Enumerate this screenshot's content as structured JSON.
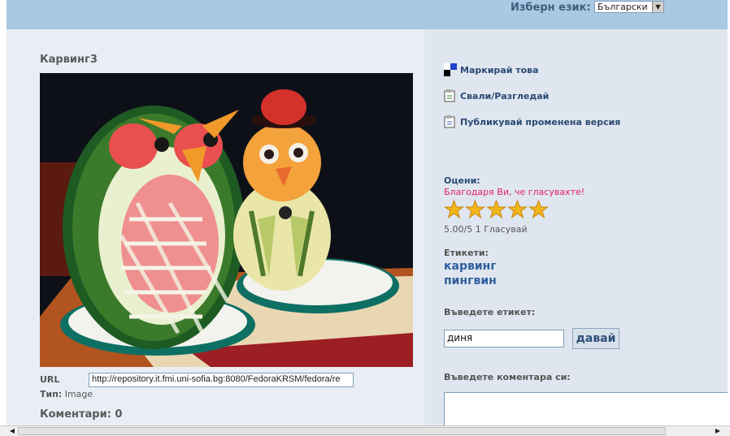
{
  "header": {
    "language_label": "Изберн език:",
    "language_selected": "Български"
  },
  "item": {
    "title": "Карвинг3",
    "url_label": "URL",
    "url_value": "http://repository.it.fmi.uni-sofia.bg:8080/FedoraKRSM/fedora/re",
    "type_label": "Тип:",
    "type_value": "Image",
    "comments_label": "Коментари: 0"
  },
  "actions": [
    {
      "label": "Маркирай това",
      "icon": "bookmark-icon"
    },
    {
      "label": "Свали/Разгледай",
      "icon": "download-icon"
    },
    {
      "label": "Публикувай променена версия",
      "icon": "publish-icon"
    }
  ],
  "rating": {
    "label": "Оцени:",
    "thanks": "Благодаря Ви, че гласувахте!",
    "stars": 5,
    "summary": "5.00/5 1 Гласувай",
    "star_color": "#f2b51c"
  },
  "tags": {
    "label": "Етикети:",
    "items": [
      "карвинг",
      "пингвин"
    ]
  },
  "tag_form": {
    "label": "Въведете етикет:",
    "value": "диня",
    "button": "давай"
  },
  "comment_form": {
    "label": "Въведете коментара си:"
  }
}
